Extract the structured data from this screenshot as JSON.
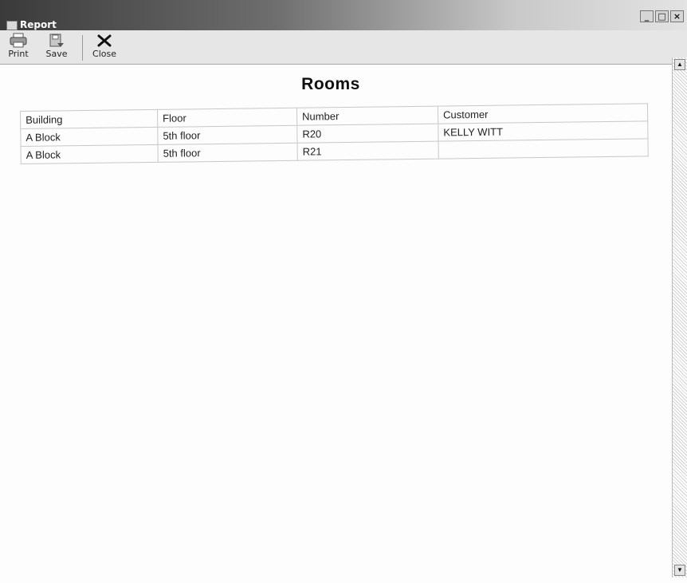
{
  "window": {
    "title": "Report",
    "controls": {
      "minimize": "_",
      "maximize": "□",
      "close": "×"
    }
  },
  "toolbar": {
    "print_label": "Print",
    "save_label": "Save",
    "close_label": "Close"
  },
  "report": {
    "title": "Rooms",
    "columns": [
      "Building",
      "Floor",
      "Number",
      "Customer"
    ],
    "rows": [
      [
        "A Block",
        "5th floor",
        "R20",
        "KELLY WITT"
      ],
      [
        "A Block",
        "5th floor",
        "R21",
        ""
      ]
    ]
  },
  "scrollbar": {
    "up": "▲",
    "down": "▼"
  }
}
